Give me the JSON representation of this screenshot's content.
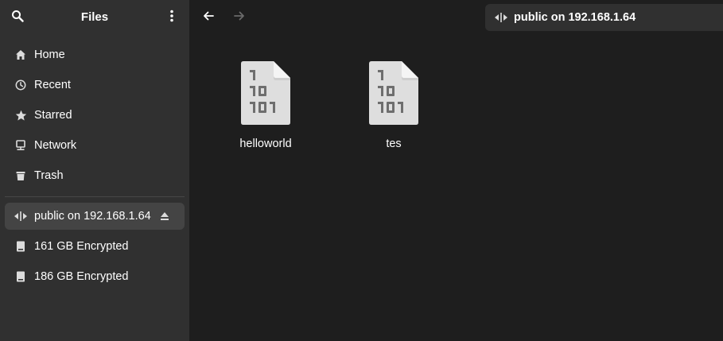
{
  "header": {
    "title": "Files",
    "search_icon": "search-icon",
    "menu_icon": "kebab-menu-icon"
  },
  "sidebar": {
    "places": [
      {
        "label": "Home",
        "icon": "home-icon"
      },
      {
        "label": "Recent",
        "icon": "clock-icon"
      },
      {
        "label": "Starred",
        "icon": "star-icon"
      },
      {
        "label": "Network",
        "icon": "network-icon"
      },
      {
        "label": "Trash",
        "icon": "trash-icon"
      }
    ],
    "devices": [
      {
        "label": "public on 192.168.1.64",
        "icon": "network-share-icon",
        "active": true,
        "eject": true
      },
      {
        "label": "161 GB Encrypted",
        "icon": "drive-icon"
      },
      {
        "label": "186 GB Encrypted",
        "icon": "drive-icon"
      }
    ]
  },
  "toolbar": {
    "back_icon": "back-arrow-icon",
    "forward_icon": "forward-arrow-icon",
    "location": "public on 192.168.1.64"
  },
  "files": [
    {
      "name": "helloworld",
      "icon": "binary-file-icon"
    },
    {
      "name": "tes",
      "icon": "binary-file-icon"
    }
  ],
  "colors": {
    "sidebar_bg": "#303030",
    "main_bg": "#1e1e1e",
    "active_item": "#444444"
  }
}
